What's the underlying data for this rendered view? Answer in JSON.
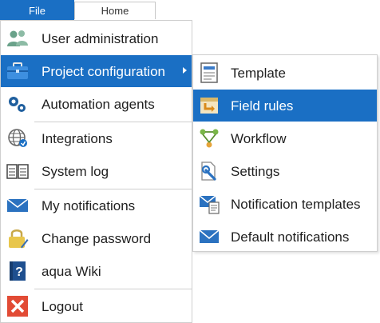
{
  "ribbon": {
    "file_tab": "File",
    "home_tab": "Home"
  },
  "menu": {
    "items": [
      {
        "label": "User administration",
        "icon": "users-icon"
      },
      {
        "label": "Project configuration",
        "icon": "briefcase-icon"
      },
      {
        "label": "Automation agents",
        "icon": "gears-icon"
      },
      {
        "label": "Integrations",
        "icon": "globe-icon"
      },
      {
        "label": "System log",
        "icon": "book-icon"
      },
      {
        "label": "My notifications",
        "icon": "envelope-icon"
      },
      {
        "label": "Change password",
        "icon": "lock-icon"
      },
      {
        "label": "aqua Wiki",
        "icon": "help-book-icon"
      },
      {
        "label": "Logout",
        "icon": "logout-icon"
      }
    ],
    "active_item": "Project configuration"
  },
  "submenu": {
    "items": [
      {
        "label": "Template",
        "icon": "template-icon"
      },
      {
        "label": "Field rules",
        "icon": "field-rules-icon"
      },
      {
        "label": "Workflow",
        "icon": "workflow-icon"
      },
      {
        "label": "Settings",
        "icon": "settings-icon"
      },
      {
        "label": "Notification templates",
        "icon": "notification-template-icon"
      },
      {
        "label": "Default notifications",
        "icon": "envelope-icon"
      }
    ],
    "hovered_item": "Field rules"
  },
  "colors": {
    "accent": "#1a6fc4",
    "border": "#cfcfcf",
    "text": "#1f1f1f"
  }
}
